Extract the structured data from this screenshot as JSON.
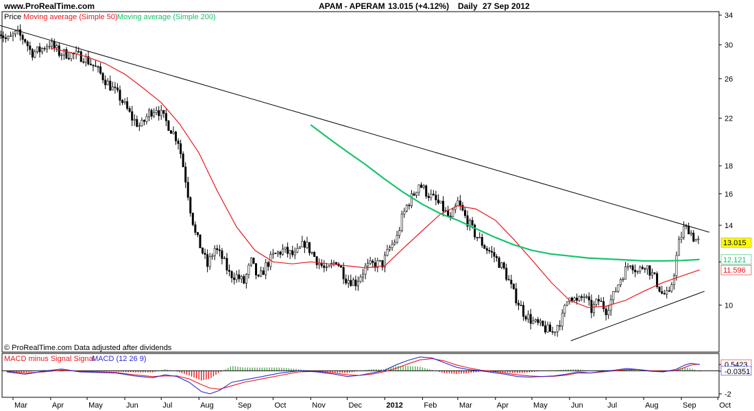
{
  "header": {
    "site": "www.ProRealTime.com",
    "title": "APAM - APERAM",
    "quote": "13.015 (+4.12%)",
    "period": "Daily",
    "date": "27 Sep 2012"
  },
  "legend": {
    "price": "Price",
    "ma50": "Moving average (Simple 50)",
    "ma200": "Moving average (Simple 200)",
    "copyright": "© ProRealTime.com  Data adjusted after dividends",
    "macd_hist": "MACD minus Signal Signal",
    "macd": "MACD (12 26 9)"
  },
  "colors": {
    "candle": "#000000",
    "ma50": "#e8161b",
    "ma200": "#14c46a",
    "trend": "#000000",
    "macd": "#2b2bd4",
    "signal": "#e8161b",
    "hist_pos": "#4caf50",
    "hist_neg": "#e8161b",
    "last_badge": "#ffff00"
  },
  "chart_data": [
    {
      "type": "line",
      "scale": "log",
      "y_ticks": [
        34,
        30,
        26,
        22,
        18,
        16,
        14,
        12,
        10
      ],
      "y_tick_labels": [
        "34",
        "30",
        "26",
        "22",
        "18",
        "16",
        "14",
        "",
        "10"
      ],
      "ylim": [
        8.2,
        34.5
      ],
      "x_range": [
        -9,
        387
      ],
      "x_labels": [
        {
          "label": "Mar",
          "day": 0
        },
        {
          "label": "Apr",
          "day": 31
        },
        {
          "label": "May",
          "day": 61
        },
        {
          "label": "Jun",
          "day": 92
        },
        {
          "label": "Jul",
          "day": 122
        },
        {
          "label": "Aug",
          "day": 153
        },
        {
          "label": "Sep",
          "day": 184
        },
        {
          "label": "Oct",
          "day": 214
        },
        {
          "label": "Nov",
          "day": 245
        },
        {
          "label": "Dec",
          "day": 275
        },
        {
          "label": "2012",
          "day": 306,
          "bold": true
        },
        {
          "label": "Feb",
          "day": 337
        },
        {
          "label": "Mar",
          "day": 366
        },
        {
          "label": "Apr",
          "day": 397
        },
        {
          "label": "May",
          "day": 427
        },
        {
          "label": "Jun",
          "day": 458
        },
        {
          "label": "Jul",
          "day": 488
        },
        {
          "label": "Aug",
          "day": 519
        },
        {
          "label": "Sep",
          "day": 550
        },
        {
          "label": "Oct",
          "day": 580
        }
      ],
      "last_price": {
        "value": 13.015,
        "label": "13.015"
      },
      "ma200_last": {
        "value": 12.121,
        "label": "12.121"
      },
      "ma50_last": {
        "value": 11.596,
        "label": "11.596"
      },
      "price_path": [
        [
          -12,
          32.0
        ],
        [
          -5,
          30.5
        ],
        [
          3,
          31.5
        ],
        [
          10,
          30.6
        ],
        [
          15,
          29.0
        ],
        [
          22,
          29.3
        ],
        [
          30,
          30.2
        ],
        [
          38,
          29.0
        ],
        [
          48,
          28.8
        ],
        [
          58,
          28.5
        ],
        [
          68,
          27.2
        ],
        [
          78,
          25.5
        ],
        [
          88,
          24.0
        ],
        [
          98,
          22.0
        ],
        [
          105,
          21.2
        ],
        [
          112,
          22.5
        ],
        [
          118,
          23.0
        ],
        [
          124,
          22.0
        ],
        [
          130,
          21.0
        ],
        [
          136,
          20.0
        ],
        [
          142,
          17.0
        ],
        [
          146,
          15.0
        ],
        [
          150,
          13.5
        ],
        [
          156,
          12.5
        ],
        [
          160,
          11.8
        ],
        [
          166,
          12.7
        ],
        [
          172,
          12.2
        ],
        [
          178,
          11.4
        ],
        [
          184,
          11.3
        ],
        [
          190,
          11.0
        ],
        [
          196,
          12.0
        ],
        [
          202,
          11.1
        ],
        [
          208,
          11.8
        ],
        [
          214,
          12.3
        ],
        [
          222,
          12.6
        ],
        [
          232,
          12.3
        ],
        [
          240,
          13.0
        ],
        [
          250,
          12.1
        ],
        [
          258,
          11.5
        ],
        [
          266,
          12.1
        ],
        [
          274,
          11.2
        ],
        [
          282,
          11.0
        ],
        [
          290,
          11.7
        ],
        [
          298,
          11.9
        ],
        [
          304,
          11.9
        ],
        [
          310,
          12.7
        ],
        [
          316,
          13.3
        ],
        [
          320,
          14.4
        ],
        [
          324,
          15.2
        ],
        [
          330,
          16.0
        ],
        [
          334,
          16.7
        ],
        [
          340,
          16.1
        ],
        [
          348,
          15.5
        ],
        [
          354,
          15.0
        ],
        [
          360,
          14.3
        ],
        [
          366,
          15.4
        ],
        [
          372,
          14.5
        ],
        [
          380,
          13.5
        ],
        [
          388,
          12.8
        ],
        [
          396,
          12.3
        ],
        [
          404,
          11.6
        ],
        [
          412,
          10.5
        ],
        [
          420,
          9.7
        ],
        [
          428,
          9.3
        ],
        [
          436,
          9.1
        ],
        [
          444,
          8.9
        ],
        [
          452,
          9.5
        ],
        [
          458,
          10.5
        ],
        [
          464,
          10.1
        ],
        [
          470,
          10.4
        ],
        [
          476,
          9.8
        ],
        [
          482,
          10.2
        ],
        [
          488,
          9.8
        ],
        [
          494,
          10.4
        ],
        [
          500,
          11.2
        ],
        [
          508,
          12.0
        ],
        [
          514,
          11.5
        ],
        [
          520,
          11.9
        ],
        [
          528,
          11.2
        ],
        [
          534,
          10.5
        ],
        [
          540,
          10.4
        ],
        [
          544,
          11.5
        ],
        [
          548,
          13.0
        ],
        [
          552,
          13.8
        ],
        [
          556,
          13.8
        ],
        [
          560,
          13.3
        ],
        [
          565,
          13.0
        ]
      ],
      "ma50_path": [
        [
          31,
          29.6
        ],
        [
          46,
          29.1
        ],
        [
          61,
          28.5
        ],
        [
          76,
          27.7
        ],
        [
          92,
          26.5
        ],
        [
          107,
          25.0
        ],
        [
          122,
          23.5
        ],
        [
          137,
          21.5
        ],
        [
          153,
          19.0
        ],
        [
          168,
          16.2
        ],
        [
          184,
          13.9
        ],
        [
          199,
          12.6
        ],
        [
          214,
          12.0
        ],
        [
          230,
          11.9
        ],
        [
          245,
          12.0
        ],
        [
          260,
          11.9
        ],
        [
          275,
          11.8
        ],
        [
          290,
          11.7
        ],
        [
          306,
          11.8
        ],
        [
          321,
          12.7
        ],
        [
          337,
          13.7
        ],
        [
          352,
          14.7
        ],
        [
          366,
          15.2
        ],
        [
          381,
          15.0
        ],
        [
          397,
          14.3
        ],
        [
          412,
          13.2
        ],
        [
          427,
          12.1
        ],
        [
          443,
          11.0
        ],
        [
          458,
          10.2
        ],
        [
          473,
          9.9
        ],
        [
          488,
          9.95
        ],
        [
          504,
          10.2
        ],
        [
          519,
          10.6
        ],
        [
          535,
          11.0
        ],
        [
          550,
          11.3
        ],
        [
          565,
          11.6
        ]
      ],
      "ma200_path": [
        [
          245,
          21.4
        ],
        [
          260,
          20.2
        ],
        [
          275,
          19.1
        ],
        [
          290,
          18.1
        ],
        [
          306,
          17.0
        ],
        [
          321,
          16.1
        ],
        [
          337,
          15.3
        ],
        [
          352,
          14.7
        ],
        [
          366,
          14.3
        ],
        [
          381,
          13.8
        ],
        [
          397,
          13.3
        ],
        [
          412,
          12.9
        ],
        [
          427,
          12.6
        ],
        [
          443,
          12.4
        ],
        [
          458,
          12.3
        ],
        [
          473,
          12.2
        ],
        [
          488,
          12.15
        ],
        [
          504,
          12.1
        ],
        [
          519,
          12.05
        ],
        [
          535,
          12.05
        ],
        [
          550,
          12.07
        ],
        [
          565,
          12.12
        ]
      ],
      "trendlines": [
        {
          "from": [
            -12,
            32.6
          ],
          "to": [
            573,
            13.6
          ]
        },
        {
          "from": [
            459,
            8.6
          ],
          "to": [
            569,
            10.6
          ]
        }
      ]
    },
    {
      "type": "line",
      "name": "MACD (12 26 9)",
      "y_ticks": [
        0.5423,
        -0.0351,
        -2
      ],
      "y_tick_labels": [
        "0.5423",
        "-0.0351",
        "-2"
      ],
      "ylim": [
        -2.3,
        1.5
      ],
      "macd_path": [
        [
          -5,
          -0.1
        ],
        [
          10,
          -0.3
        ],
        [
          25,
          -0.05
        ],
        [
          40,
          0.15
        ],
        [
          55,
          -0.1
        ],
        [
          70,
          -0.15
        ],
        [
          85,
          -0.2
        ],
        [
          100,
          -0.45
        ],
        [
          115,
          -0.6
        ],
        [
          125,
          -0.35
        ],
        [
          135,
          -0.5
        ],
        [
          145,
          -1.0
        ],
        [
          155,
          -1.8
        ],
        [
          162,
          -2.0
        ],
        [
          170,
          -1.7
        ],
        [
          180,
          -1.0
        ],
        [
          190,
          -0.8
        ],
        [
          205,
          -0.5
        ],
        [
          220,
          -0.2
        ],
        [
          235,
          0.0
        ],
        [
          250,
          -0.1
        ],
        [
          265,
          -0.3
        ],
        [
          275,
          -0.5
        ],
        [
          285,
          -0.4
        ],
        [
          295,
          -0.2
        ],
        [
          305,
          0.0
        ],
        [
          315,
          0.5
        ],
        [
          325,
          0.9
        ],
        [
          335,
          1.2
        ],
        [
          345,
          1.1
        ],
        [
          355,
          0.7
        ],
        [
          365,
          0.3
        ],
        [
          375,
          0.1
        ],
        [
          385,
          0.0
        ],
        [
          395,
          -0.15
        ],
        [
          405,
          -0.3
        ],
        [
          415,
          -0.5
        ],
        [
          425,
          -0.55
        ],
        [
          435,
          -0.5
        ],
        [
          445,
          -0.45
        ],
        [
          455,
          -0.3
        ],
        [
          465,
          -0.1
        ],
        [
          475,
          -0.2
        ],
        [
          485,
          -0.05
        ],
        [
          495,
          0.05
        ],
        [
          505,
          0.2
        ],
        [
          515,
          0.1
        ],
        [
          525,
          -0.05
        ],
        [
          535,
          -0.1
        ],
        [
          545,
          0.1
        ],
        [
          553,
          0.5
        ],
        [
          558,
          0.65
        ],
        [
          565,
          0.54
        ]
      ],
      "signal_path": [
        [
          -5,
          -0.05
        ],
        [
          10,
          -0.2
        ],
        [
          25,
          -0.1
        ],
        [
          40,
          0.05
        ],
        [
          55,
          -0.05
        ],
        [
          70,
          -0.1
        ],
        [
          85,
          -0.15
        ],
        [
          100,
          -0.35
        ],
        [
          115,
          -0.5
        ],
        [
          125,
          -0.45
        ],
        [
          135,
          -0.45
        ],
        [
          145,
          -0.7
        ],
        [
          155,
          -1.2
        ],
        [
          162,
          -1.5
        ],
        [
          170,
          -1.6
        ],
        [
          180,
          -1.3
        ],
        [
          190,
          -1.0
        ],
        [
          205,
          -0.7
        ],
        [
          220,
          -0.4
        ],
        [
          235,
          -0.1
        ],
        [
          250,
          -0.05
        ],
        [
          265,
          -0.2
        ],
        [
          275,
          -0.35
        ],
        [
          285,
          -0.4
        ],
        [
          295,
          -0.3
        ],
        [
          305,
          -0.1
        ],
        [
          315,
          0.2
        ],
        [
          325,
          0.6
        ],
        [
          335,
          0.95
        ],
        [
          345,
          1.05
        ],
        [
          355,
          0.85
        ],
        [
          365,
          0.5
        ],
        [
          375,
          0.25
        ],
        [
          385,
          0.05
        ],
        [
          395,
          -0.05
        ],
        [
          405,
          -0.2
        ],
        [
          415,
          -0.35
        ],
        [
          425,
          -0.45
        ],
        [
          435,
          -0.5
        ],
        [
          445,
          -0.48
        ],
        [
          455,
          -0.38
        ],
        [
          465,
          -0.2
        ],
        [
          475,
          -0.2
        ],
        [
          485,
          -0.1
        ],
        [
          495,
          0.0
        ],
        [
          505,
          0.1
        ],
        [
          515,
          0.1
        ],
        [
          525,
          0.0
        ],
        [
          535,
          -0.05
        ],
        [
          545,
          0.0
        ],
        [
          553,
          0.3
        ],
        [
          558,
          0.5
        ],
        [
          565,
          0.58
        ]
      ]
    }
  ]
}
